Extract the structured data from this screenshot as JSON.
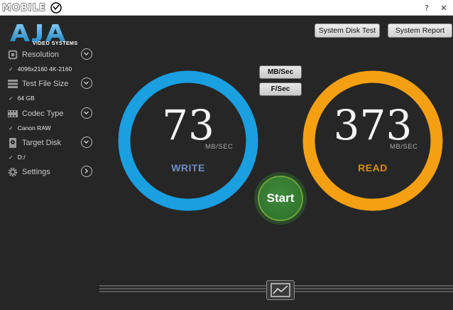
{
  "titlebar": {
    "watermark_text": "MOBILE",
    "help_label": "?",
    "close_label": "✕"
  },
  "brand": {
    "logo": "AJA",
    "subtitle": "VIDEO SYSTEMS"
  },
  "sidebar": {
    "items": [
      {
        "label": "Resolution",
        "value": "4096x2160 4K-2160",
        "icon": "chip-icon"
      },
      {
        "label": "Test File Size",
        "value": "64 GB",
        "icon": "stack-icon"
      },
      {
        "label": "Codec Type",
        "value": "Canon RAW",
        "icon": "film-icon"
      },
      {
        "label": "Target Disk",
        "value": "D:/",
        "icon": "disk-icon"
      },
      {
        "label": "Settings",
        "value": null,
        "icon": "gear-icon"
      }
    ],
    "check_mark": "✓"
  },
  "toolbar": {
    "system_disk_test": "System Disk Test",
    "system_report": "System Report"
  },
  "units": {
    "mb_per_sec": "MB/Sec",
    "frames_per_sec": "F/Sec"
  },
  "write": {
    "value": "73",
    "unit": "MB/SEC",
    "label": "WRITE",
    "color": "#1a9fe0"
  },
  "read": {
    "value": "373",
    "unit": "MB/SEC",
    "label": "READ",
    "color": "#f5a013"
  },
  "start_label": "Start",
  "colors": {
    "background": "#262626",
    "write_ring": "#1a9fe0",
    "read_ring": "#f5a013",
    "start_green": "#3f8a3a",
    "write_label": "#6e8fc2",
    "read_label": "#d98c1a"
  }
}
